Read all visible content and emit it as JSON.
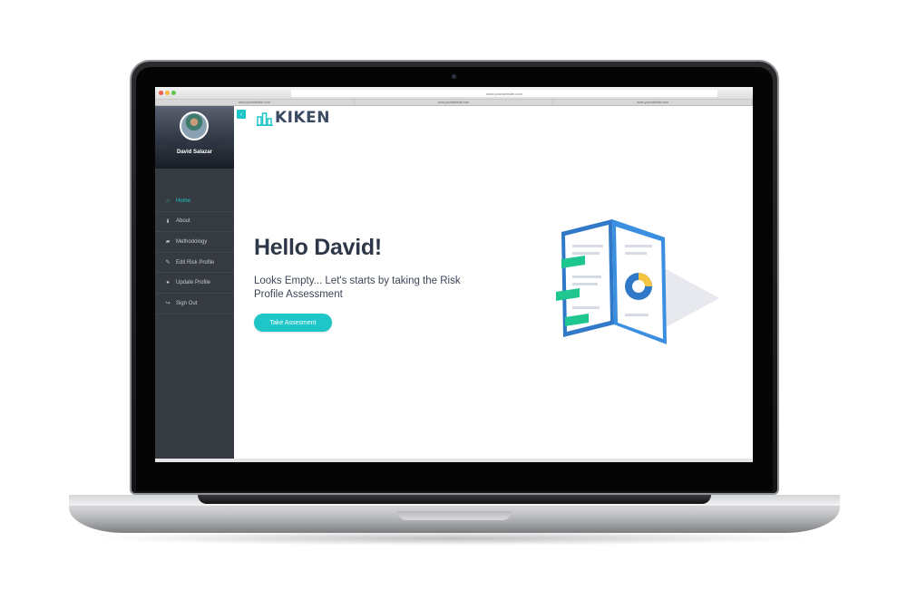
{
  "browser": {
    "url": "www.yourwebsite.com",
    "tabs": [
      "www.yourwebsite.com",
      "www.yourwebsite.com",
      "www.yourwebsite.com"
    ]
  },
  "sidebar": {
    "user_name": "David Salazar",
    "items": [
      {
        "label": "Home",
        "icon": "home-icon"
      },
      {
        "label": "About",
        "icon": "download-icon"
      },
      {
        "label": "Methodology",
        "icon": "graduation-cap-icon"
      },
      {
        "label": "Edit Risk Profile",
        "icon": "edit-icon"
      },
      {
        "label": "Update Profile",
        "icon": "user-icon"
      },
      {
        "label": "Sign Out",
        "icon": "sign-out-icon"
      }
    ]
  },
  "header": {
    "collapse_glyph": "‹",
    "logo_text": "KIKEN"
  },
  "main": {
    "greeting": "Hello David!",
    "message": "Looks Empty... Let's starts by taking the Risk Profile Assessment",
    "cta_label": "Take Assesment"
  },
  "colors": {
    "accent": "#1fc6c8",
    "sidebar_bg": "#363b42",
    "heading": "#2e3748"
  }
}
